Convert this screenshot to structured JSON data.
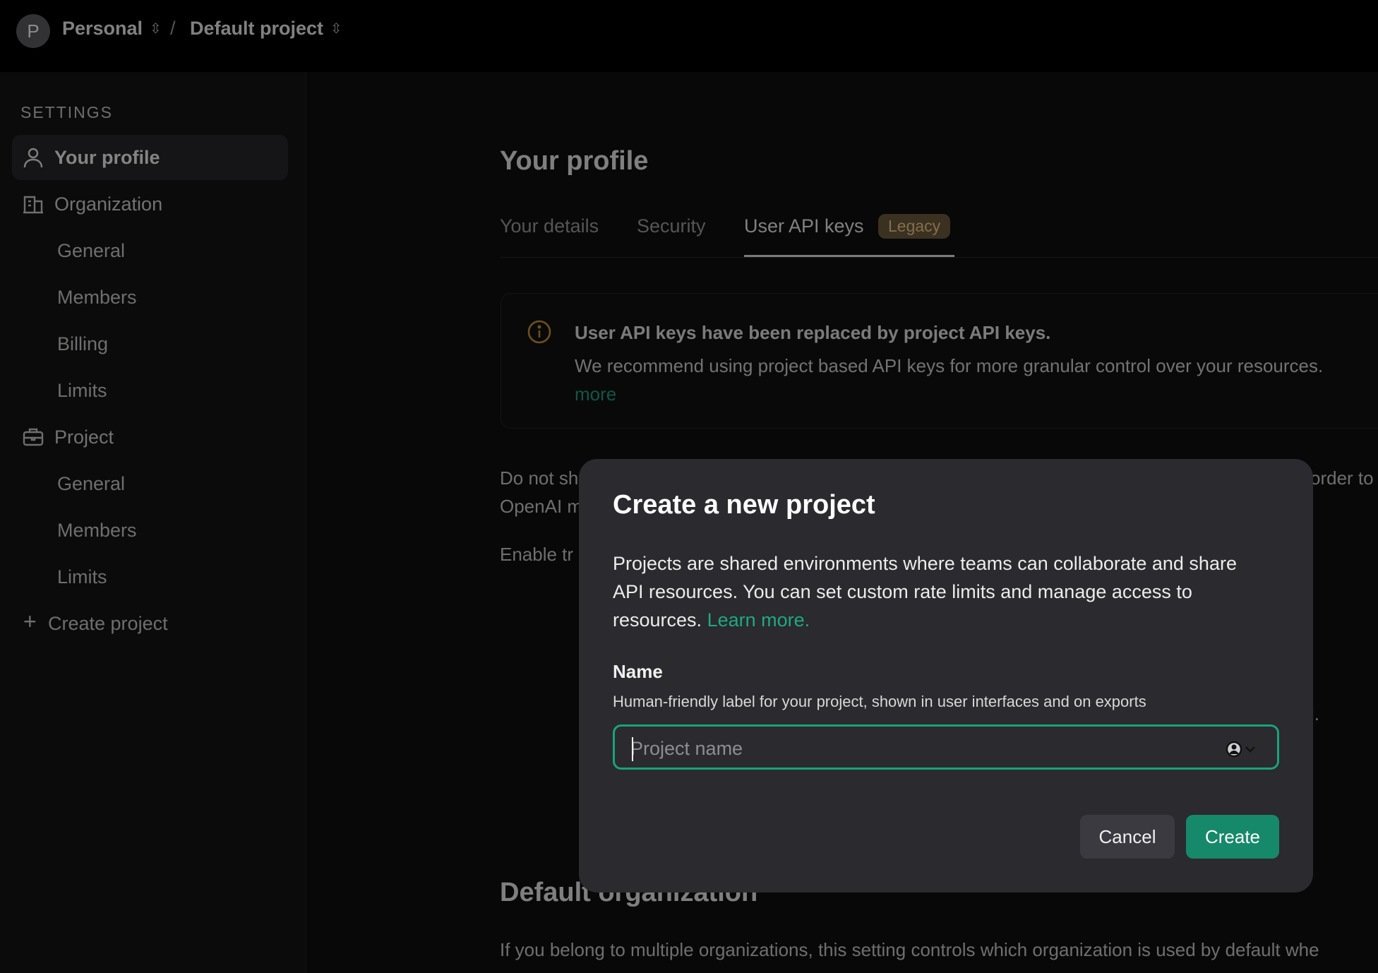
{
  "topbar": {
    "avatar_letter": "P",
    "org_label": "Personal",
    "separator": "/",
    "project_label": "Default project"
  },
  "sidebar": {
    "heading": "SETTINGS",
    "your_profile": "Your profile",
    "organization": "Organization",
    "org_items": [
      "General",
      "Members",
      "Billing",
      "Limits"
    ],
    "project": "Project",
    "project_items": [
      "General",
      "Members",
      "Limits"
    ],
    "create_project": "Create project"
  },
  "main": {
    "title": "Your profile",
    "tabs": [
      {
        "label": "Your details"
      },
      {
        "label": "Security"
      },
      {
        "label": "User API keys"
      }
    ],
    "legacy_badge": "Legacy",
    "notice": {
      "title": "User API keys have been replaced by project API keys.",
      "text": "We recommend using project based API keys for more granular control over your resources.",
      "link": "more"
    },
    "bg_line1_left": "Do not sh",
    "bg_line1_right": "order to",
    "bg_line2": "OpenAI m",
    "bg_line3": "Enable tr",
    "bg_fragment": "l.",
    "default_org_title": "Default organization",
    "default_org_text": "If you belong to multiple organizations, this setting controls which organization is used by default whe"
  },
  "modal": {
    "title": "Create a new project",
    "description": "Projects are shared environments where teams can collaborate and share API resources. You can set custom rate limits and manage access to resources.",
    "learn_more": "Learn more.",
    "name_label": "Name",
    "name_help": "Human-friendly label for your project, shown in user interfaces and on exports",
    "name_placeholder": "Project name",
    "name_value": "",
    "cancel_label": "Cancel",
    "create_label": "Create"
  },
  "colors": {
    "accent": "#16896a",
    "focus_border": "#19a37a",
    "legacy_bg": "#6b5a3c",
    "legacy_text": "#f0c98a",
    "notice_icon": "#c9922f"
  },
  "icons": [
    "user-icon",
    "building-icon",
    "briefcase-icon",
    "plus-icon",
    "info-icon",
    "chevron-updown-icon",
    "password-manager-icon"
  ]
}
